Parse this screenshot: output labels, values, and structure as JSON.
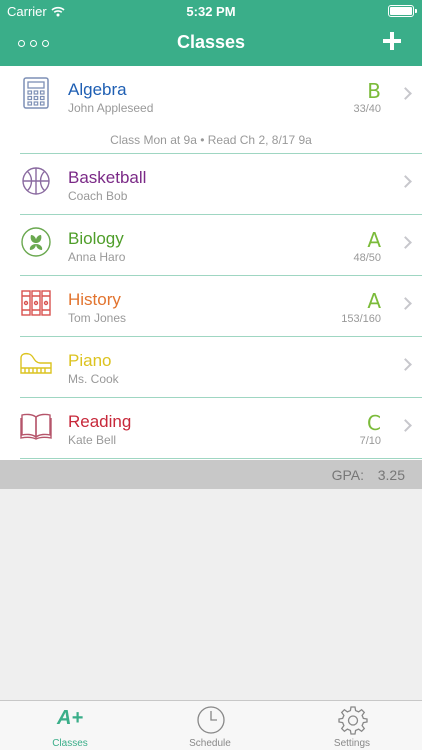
{
  "status_bar": {
    "carrier": "Carrier",
    "time": "5:32 PM"
  },
  "nav": {
    "title": "Classes",
    "more_icon": "more-icon",
    "add_icon": "plus-icon"
  },
  "colors": {
    "accent": "#3aae89",
    "grade": "#7bbb3a",
    "divider": "#9fd6c2"
  },
  "classes": [
    {
      "name": "Algebra",
      "teacher": "John Appleseed",
      "grade": "B",
      "points": "33/40",
      "color": "#1f5fb3",
      "icon": "calculator-icon",
      "note": "Class Mon at 9a • Read Ch 2, 8/17 9a"
    },
    {
      "name": "Basketball",
      "teacher": "Coach Bob",
      "grade": "",
      "points": "",
      "color": "#7b2a87",
      "icon": "basketball-icon"
    },
    {
      "name": "Biology",
      "teacher": "Anna Haro",
      "grade": "A",
      "points": "48/50",
      "color": "#4f9e2a",
      "icon": "leaf-icon"
    },
    {
      "name": "History",
      "teacher": "Tom Jones",
      "grade": "A",
      "points": "153/160",
      "color": "#e2742f",
      "icon": "books-icon"
    },
    {
      "name": "Piano",
      "teacher": "Ms. Cook",
      "grade": "",
      "points": "",
      "color": "#dcc320",
      "icon": "piano-icon"
    },
    {
      "name": "Reading",
      "teacher": "Kate Bell",
      "grade": "C",
      "points": "7/10",
      "color": "#c7283a",
      "icon": "open-book-icon"
    }
  ],
  "gpa": {
    "label": "GPA:",
    "value": "3.25"
  },
  "tabs": [
    {
      "label": "Classes",
      "icon": "a-plus-icon",
      "glyph": "A+",
      "active": true
    },
    {
      "label": "Schedule",
      "icon": "clock-icon",
      "active": false
    },
    {
      "label": "Settings",
      "icon": "gear-icon",
      "active": false
    }
  ]
}
